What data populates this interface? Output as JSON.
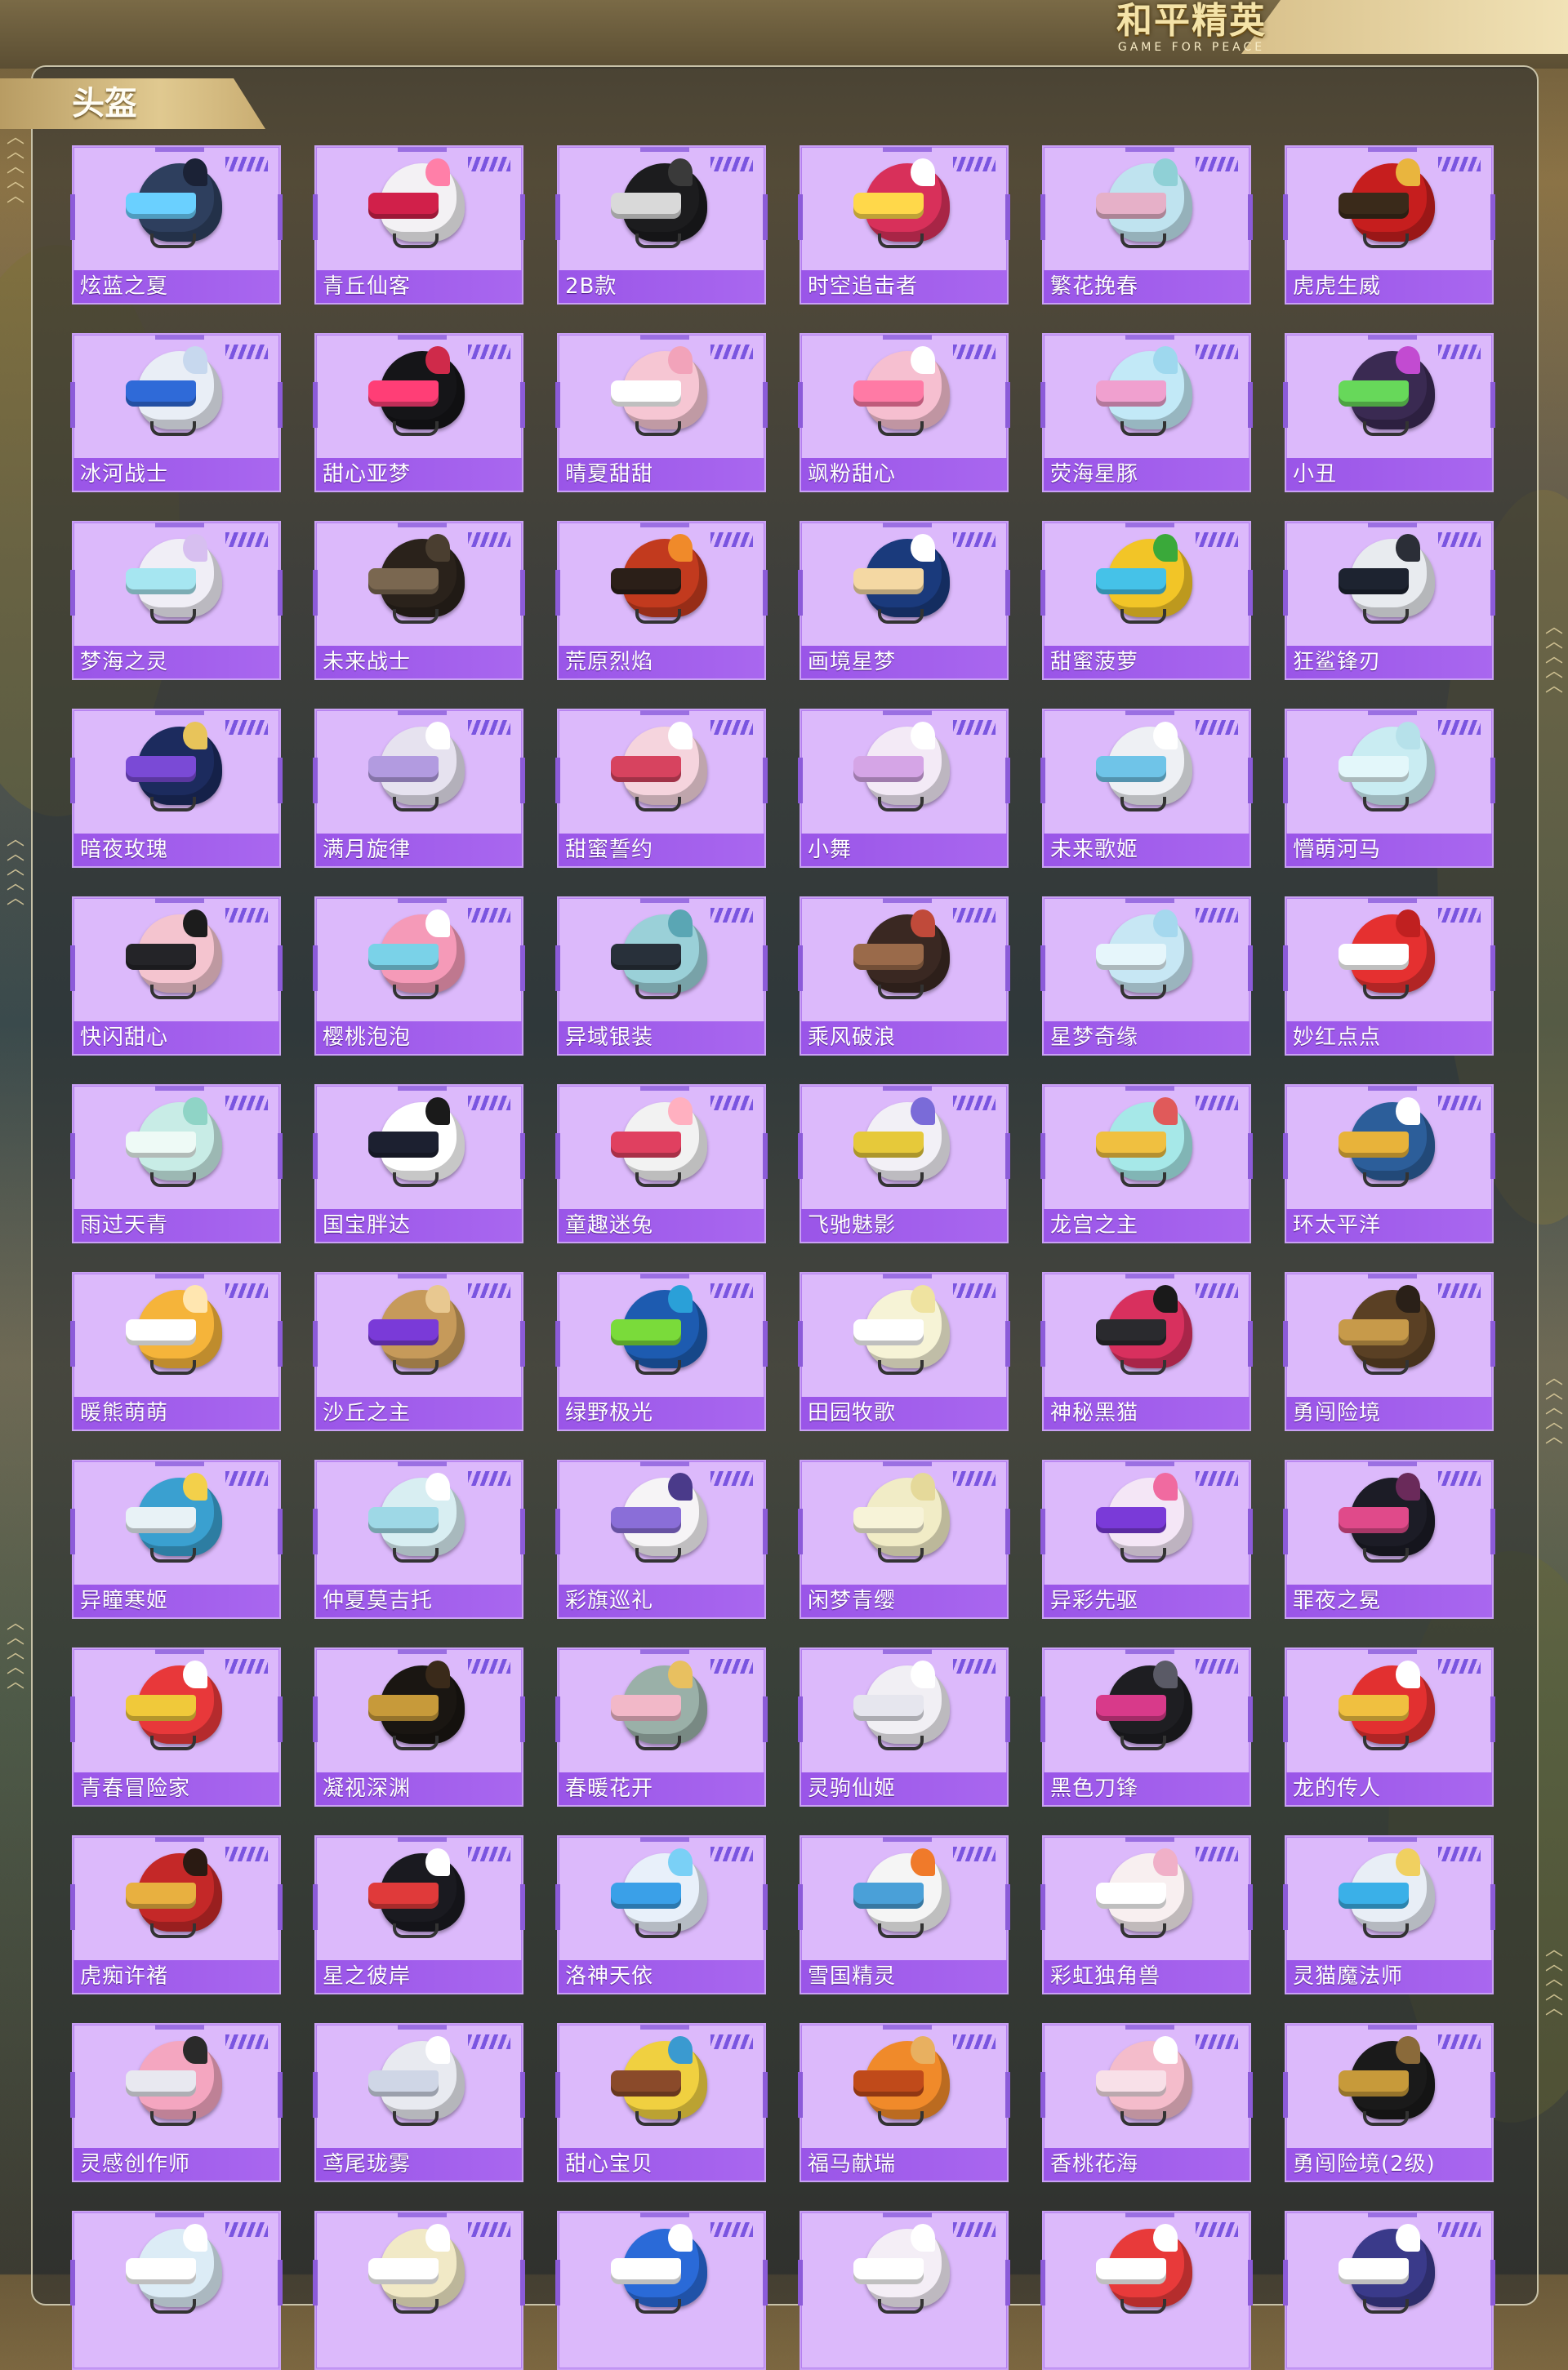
{
  "header": {
    "logo_cn": "和平精英",
    "logo_en": "GAME FOR PEACE"
  },
  "section": {
    "title": "头盔"
  },
  "colors": {
    "card_bg": "#dcb9fb",
    "label_bg": "#a05ded",
    "panel_border": "#c8c2a8",
    "tab_gold": "#d9c287"
  },
  "helmets": [
    {
      "name": "炫蓝之夏",
      "dome": "#2e3f5e",
      "visor": "#6ad0ff",
      "accent": "#1b2236"
    },
    {
      "name": "青丘仙客",
      "dome": "#f3f1f4",
      "visor": "#d1204a",
      "accent": "#ff7fa8"
    },
    {
      "name": "2B款",
      "dome": "#1c1c1e",
      "visor": "#d9d9d9",
      "accent": "#3a3a3a"
    },
    {
      "name": "时空追击者",
      "dome": "#d8305a",
      "visor": "#ffd84a",
      "accent": "#ffffff"
    },
    {
      "name": "繁花挽春",
      "dome": "#bfe3ef",
      "visor": "#e6b0c8",
      "accent": "#8fd0d6"
    },
    {
      "name": "虎虎生威",
      "dome": "#c61e1e",
      "visor": "#3a2a1a",
      "accent": "#e9b53e"
    },
    {
      "name": "冰河战士",
      "dome": "#e9eef6",
      "visor": "#2f6ad8",
      "accent": "#c7d8ee"
    },
    {
      "name": "甜心亚梦",
      "dome": "#151518",
      "visor": "#ff3e76",
      "accent": "#cf2a4a"
    },
    {
      "name": "晴夏甜甜",
      "dome": "#f6c6d3",
      "visor": "#ffffff",
      "accent": "#f2a3ba"
    },
    {
      "name": "飒粉甜心",
      "dome": "#f6bfd0",
      "visor": "#ff7aa5",
      "accent": "#ffffff"
    },
    {
      "name": "荧海星豚",
      "dome": "#c2e9f7",
      "visor": "#f0a0cf",
      "accent": "#9ed8ee"
    },
    {
      "name": "小丑",
      "dome": "#3a2a52",
      "visor": "#67d85a",
      "accent": "#c24bd1"
    },
    {
      "name": "梦海之灵",
      "dome": "#f0eef6",
      "visor": "#a6e6f1",
      "accent": "#d7bff0"
    },
    {
      "name": "未来战士",
      "dome": "#2a221b",
      "visor": "#7a6750",
      "accent": "#4a3e30"
    },
    {
      "name": "荒原烈焰",
      "dome": "#c23a1e",
      "visor": "#2b1f18",
      "accent": "#f08a2a"
    },
    {
      "name": "画境星梦",
      "dome": "#1a3a7c",
      "visor": "#f4d8a3",
      "accent": "#ffffff"
    },
    {
      "name": "甜蜜菠萝",
      "dome": "#f2c527",
      "visor": "#45c2e8",
      "accent": "#3aa93a"
    },
    {
      "name": "狂鲨锋刃",
      "dome": "#e8ebef",
      "visor": "#1d2330",
      "accent": "#2b2e37"
    },
    {
      "name": "暗夜玫瑰",
      "dome": "#1c2b5e",
      "visor": "#7a4ad6",
      "accent": "#e8c45a"
    },
    {
      "name": "满月旋律",
      "dome": "#e6e2ef",
      "visor": "#b29be0",
      "accent": "#ffffff"
    },
    {
      "name": "甜蜜誓约",
      "dome": "#f5d4dd",
      "visor": "#d7435f",
      "accent": "#ffffff"
    },
    {
      "name": "小舞",
      "dome": "#f3eaf6",
      "visor": "#d5a5e6",
      "accent": "#ffffff"
    },
    {
      "name": "未来歌姬",
      "dome": "#eef0f4",
      "visor": "#6fc4e8",
      "accent": "#ffffff"
    },
    {
      "name": "懵萌河马",
      "dome": "#c9ecf2",
      "visor": "#e3f7fa",
      "accent": "#b6e1ea"
    },
    {
      "name": "快闪甜心",
      "dome": "#f4c4cf",
      "visor": "#242428",
      "accent": "#1c1c1c"
    },
    {
      "name": "樱桃泡泡",
      "dome": "#f59ab8",
      "visor": "#7ad2e8",
      "accent": "#ffffff"
    },
    {
      "name": "异域银装",
      "dome": "#9ad0d8",
      "visor": "#28303a",
      "accent": "#5aa6b4"
    },
    {
      "name": "乘风破浪",
      "dome": "#3a2822",
      "visor": "#9a6a4a",
      "accent": "#c04a3a"
    },
    {
      "name": "星梦奇缘",
      "dome": "#c7e7f4",
      "visor": "#e6f6fb",
      "accent": "#a5d8ee"
    },
    {
      "name": "妙红点点",
      "dome": "#e53030",
      "visor": "#ffffff",
      "accent": "#c02020"
    },
    {
      "name": "雨过天青",
      "dome": "#c8ece6",
      "visor": "#eefaf6",
      "accent": "#8fd4c6"
    },
    {
      "name": "国宝胖达",
      "dome": "#ffffff",
      "visor": "#1c2030",
      "accent": "#1a1a1a"
    },
    {
      "name": "童趣迷兔",
      "dome": "#f2f2f2",
      "visor": "#e04060",
      "accent": "#ffb0c0"
    },
    {
      "name": "飞驰魅影",
      "dome": "#f2f0f6",
      "visor": "#e6c93a",
      "accent": "#7a6bd8"
    },
    {
      "name": "龙宫之主",
      "dome": "#a6e8e8",
      "visor": "#f0c040",
      "accent": "#e05a5a"
    },
    {
      "name": "环太平洋",
      "dome": "#2c5e9a",
      "visor": "#e8b33a",
      "accent": "#ffffff"
    },
    {
      "name": "暖熊萌萌",
      "dome": "#f5b43a",
      "visor": "#ffffff",
      "accent": "#ffe6b0"
    },
    {
      "name": "沙丘之主",
      "dome": "#c69a5a",
      "visor": "#7a3ad8",
      "accent": "#e8c890"
    },
    {
      "name": "绿野极光",
      "dome": "#1d5bb0",
      "visor": "#7adb3a",
      "accent": "#2aa0d8"
    },
    {
      "name": "田园牧歌",
      "dome": "#f6f3d6",
      "visor": "#ffffff",
      "accent": "#efe3a0"
    },
    {
      "name": "神秘黑猫",
      "dome": "#d8305e",
      "visor": "#2a2a2e",
      "accent": "#1a1a1a"
    },
    {
      "name": "勇闯险境",
      "dome": "#5a4024",
      "visor": "#c79a4a",
      "accent": "#2a2018"
    },
    {
      "name": "异瞳寒姬",
      "dome": "#3aa0d0",
      "visor": "#e8f2f6",
      "accent": "#f3d04a"
    },
    {
      "name": "仲夏莫吉托",
      "dome": "#d8eef2",
      "visor": "#9ed8e6",
      "accent": "#ffffff"
    },
    {
      "name": "彩旗巡礼",
      "dome": "#f6f4f6",
      "visor": "#8a6ed8",
      "accent": "#4a3a8a"
    },
    {
      "name": "闲梦青缨",
      "dome": "#f1ecc6",
      "visor": "#f7f3d8",
      "accent": "#e5d99a"
    },
    {
      "name": "异彩先驱",
      "dome": "#f4e6f6",
      "visor": "#7a3ad8",
      "accent": "#f06aa0"
    },
    {
      "name": "罪夜之冕",
      "dome": "#1c1c26",
      "visor": "#e04a8a",
      "accent": "#6a2a5a"
    },
    {
      "name": "青春冒险家",
      "dome": "#e8383a",
      "visor": "#f0c93a",
      "accent": "#ffffff"
    },
    {
      "name": "凝视深渊",
      "dome": "#1a1612",
      "visor": "#c79a3a",
      "accent": "#3a2a1a"
    },
    {
      "name": "春暖花开",
      "dome": "#9ab0a8",
      "visor": "#f2b8c8",
      "accent": "#e8c060"
    },
    {
      "name": "灵驹仙姬",
      "dome": "#f1eff4",
      "visor": "#e6e6ee",
      "accent": "#ffffff"
    },
    {
      "name": "黑色刀锋",
      "dome": "#1e1e22",
      "visor": "#d83a8a",
      "accent": "#5a5a66"
    },
    {
      "name": "龙的传人",
      "dome": "#e23030",
      "visor": "#f0c040",
      "accent": "#ffffff"
    },
    {
      "name": "虎痴许褚",
      "dome": "#c42828",
      "visor": "#e8b040",
      "accent": "#2a1a12"
    },
    {
      "name": "星之彼岸",
      "dome": "#1a1a20",
      "visor": "#e03a3a",
      "accent": "#ffffff"
    },
    {
      "name": "洛神天依",
      "dome": "#e8f0fa",
      "visor": "#3aa0e8",
      "accent": "#7ad0f6"
    },
    {
      "name": "雪国精灵",
      "dome": "#f5f5f5",
      "visor": "#4aa0d8",
      "accent": "#f07a2a"
    },
    {
      "name": "彩虹独角兽",
      "dome": "#f8eff0",
      "visor": "#ffffff",
      "accent": "#f0b0c8"
    },
    {
      "name": "灵猫魔法师",
      "dome": "#e8eef6",
      "visor": "#3ab0e8",
      "accent": "#f0d060"
    },
    {
      "name": "灵感创作师",
      "dome": "#f4a6c0",
      "visor": "#e8e8f0",
      "accent": "#2a2a2a"
    },
    {
      "name": "鸢尾珑雾",
      "dome": "#e8eaf0",
      "visor": "#cfd6e6",
      "accent": "#ffffff"
    },
    {
      "name": "甜心宝贝",
      "dome": "#f0d040",
      "visor": "#8a4a2a",
      "accent": "#3a9ad0"
    },
    {
      "name": "福马献瑞",
      "dome": "#f08a2a",
      "visor": "#c04a1a",
      "accent": "#e8b060"
    },
    {
      "name": "香桃花海",
      "dome": "#f4bccb",
      "visor": "#f8e0e8",
      "accent": "#ffffff"
    },
    {
      "name": "勇闯险境(2级)",
      "dome": "#1a1a1a",
      "visor": "#c79a3a",
      "accent": "#8a6a3a"
    },
    {
      "name": "",
      "dome": "#dcecf6",
      "visor": "#ffffff",
      "accent": "#ffffff"
    },
    {
      "name": "",
      "dome": "#f1e9c6",
      "visor": "#ffffff",
      "accent": "#ffffff"
    },
    {
      "name": "",
      "dome": "#2a6ad8",
      "visor": "#ffffff",
      "accent": "#ffffff"
    },
    {
      "name": "",
      "dome": "#f4eef6",
      "visor": "#ffffff",
      "accent": "#ffffff"
    },
    {
      "name": "",
      "dome": "#e83a3a",
      "visor": "#ffffff",
      "accent": "#ffffff"
    },
    {
      "name": "",
      "dome": "#3a3a8a",
      "visor": "#ffffff",
      "accent": "#ffffff"
    }
  ]
}
